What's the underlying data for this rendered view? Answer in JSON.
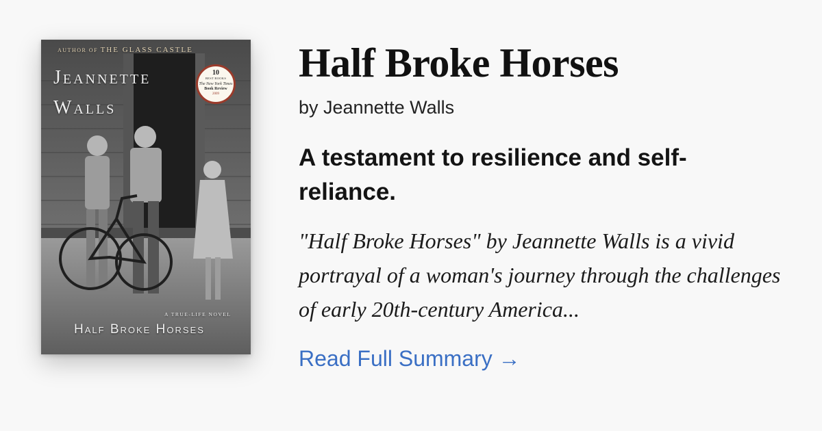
{
  "book": {
    "title": "Half Broke Horses",
    "byline": "by Jeannette Walls",
    "tagline": "A testament to resilience and self-reliance.",
    "summary": "\"Half Broke Horses\" by Jeannette Walls is a vivid portrayal of a woman's journey through the challenges of early 20th-century America...",
    "read_more": "Read Full Summary →"
  },
  "cover": {
    "author_prefix": "AUTHOR OF ",
    "author_of": "THE GLASS CASTLE",
    "name_first": "Jeannette",
    "name_last": "Walls",
    "seal": {
      "number": "10",
      "label": "BEST BOOKS",
      "publication": "The New York Times",
      "review": "Book Review",
      "year": "2009"
    },
    "subtitle": "A TRUE-LIFE NOVEL",
    "title": "Half Broke Horses"
  },
  "colors": {
    "background": "#f8f8f8",
    "link": "#3a6fc4",
    "seal_ring": "#9a3b2b"
  }
}
